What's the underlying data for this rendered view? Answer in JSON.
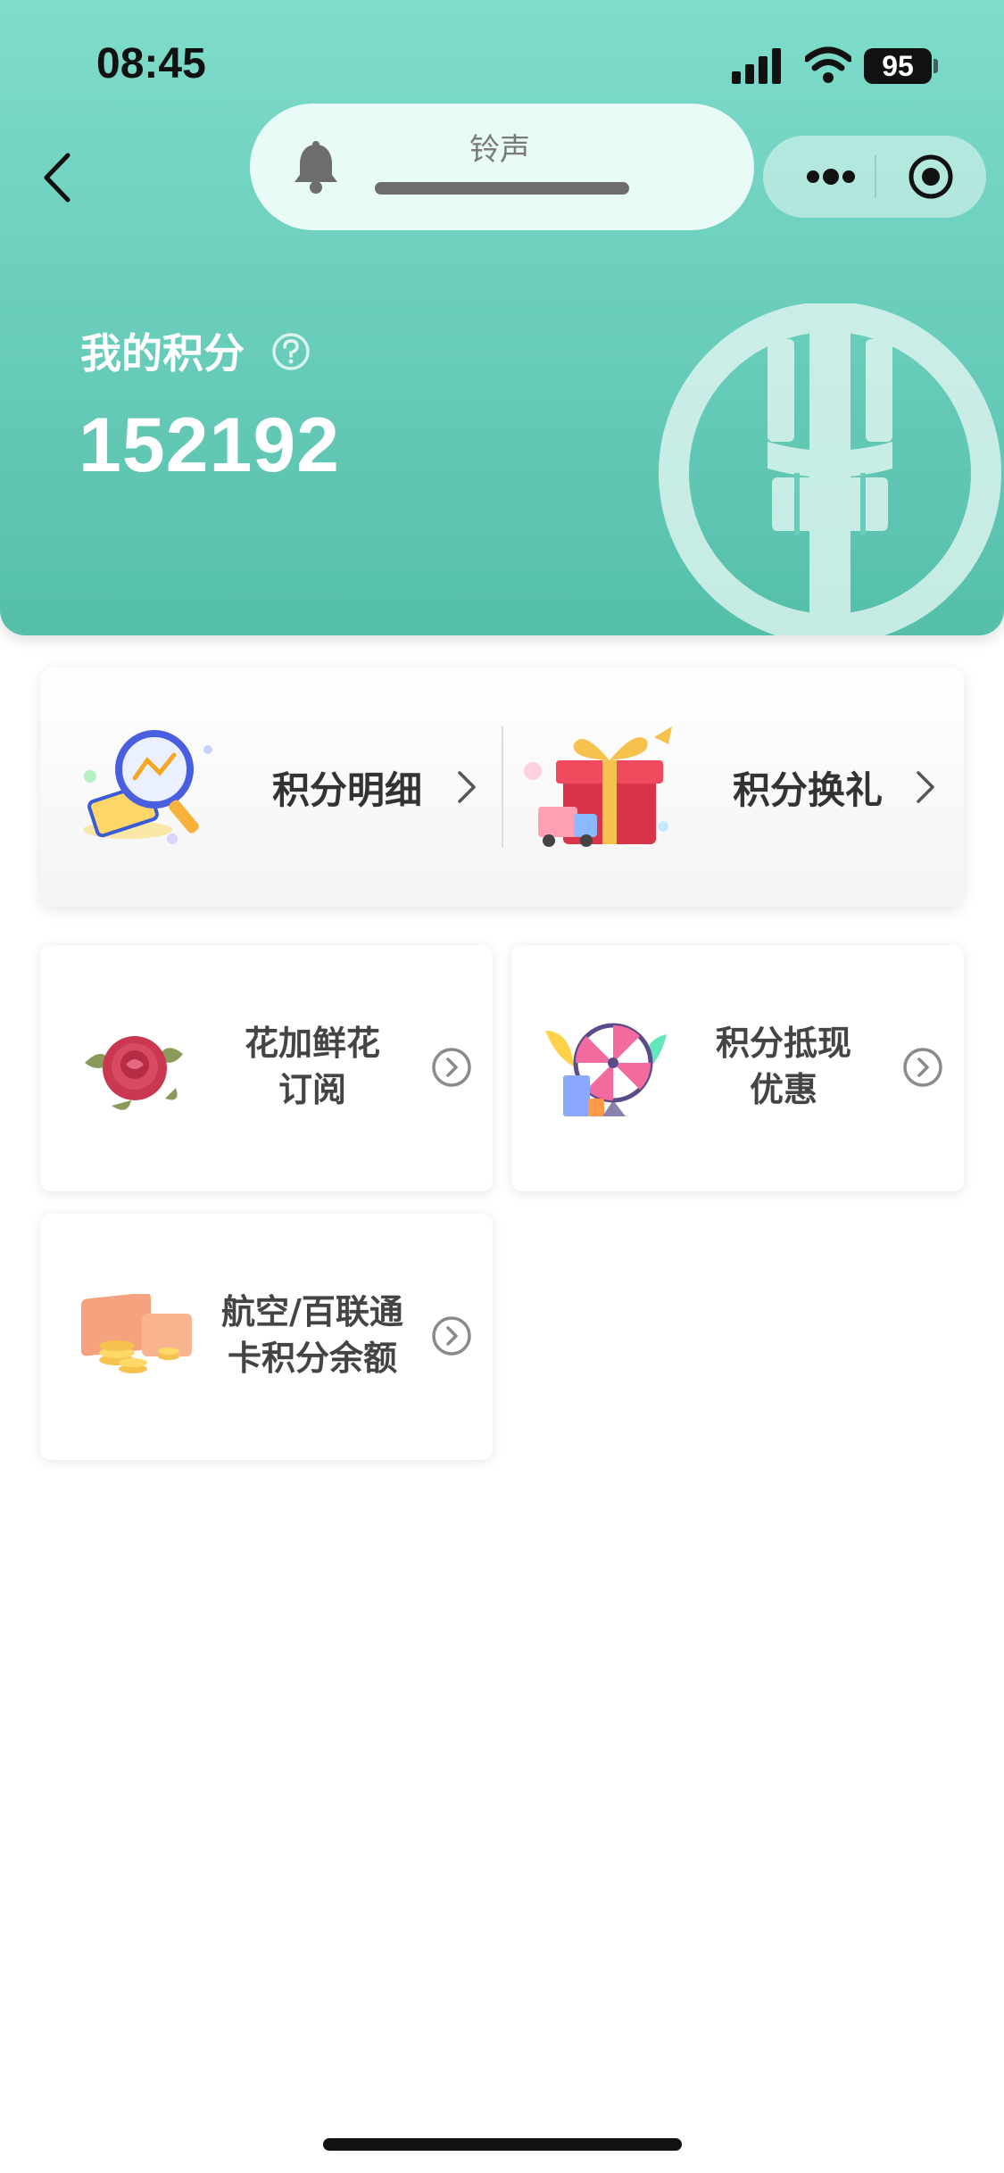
{
  "status_bar": {
    "time": "08:45",
    "battery": "95"
  },
  "nav": {
    "ringtone_label": "铃声"
  },
  "points": {
    "label": "我的积分",
    "value": "152192"
  },
  "top_actions": [
    {
      "label": "积分明细",
      "icon": "magnifier-chart-icon"
    },
    {
      "label": "积分换礼",
      "icon": "gift-box-icon"
    }
  ],
  "cards": [
    {
      "line1": "花加鲜花",
      "line2": "订阅",
      "icon": "rose-flower-icon"
    },
    {
      "line1": "积分抵现",
      "line2": "优惠",
      "icon": "prize-wheel-icon"
    },
    {
      "line1": "航空/百联通",
      "line2": "卡积分余额",
      "icon": "card-coins-icon"
    }
  ],
  "colors": {
    "header_start": "#7fdccb",
    "header_end": "#55bfaa",
    "text_dark": "#333333"
  }
}
